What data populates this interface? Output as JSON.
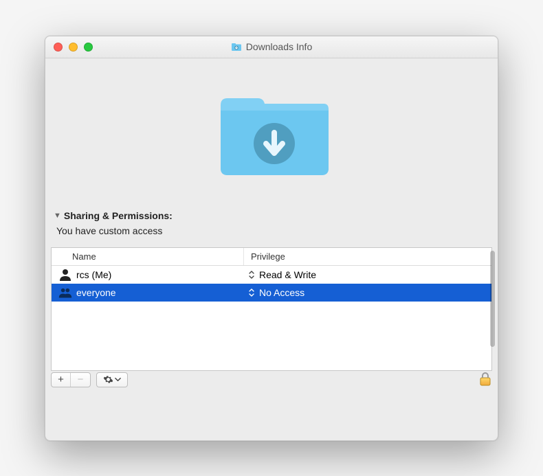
{
  "window": {
    "title": "Downloads Info"
  },
  "section": {
    "header": "Sharing & Permissions:",
    "access_text": "You have custom access"
  },
  "table": {
    "columns": {
      "name": "Name",
      "privilege": "Privilege"
    },
    "rows": [
      {
        "user": "rcs (Me)",
        "privilege": "Read & Write",
        "selected": false,
        "icon": "single"
      },
      {
        "user": "everyone",
        "privilege": "No Access",
        "selected": true,
        "icon": "group"
      }
    ]
  },
  "toolbar": {
    "add_label": "+",
    "remove_label": "−"
  }
}
